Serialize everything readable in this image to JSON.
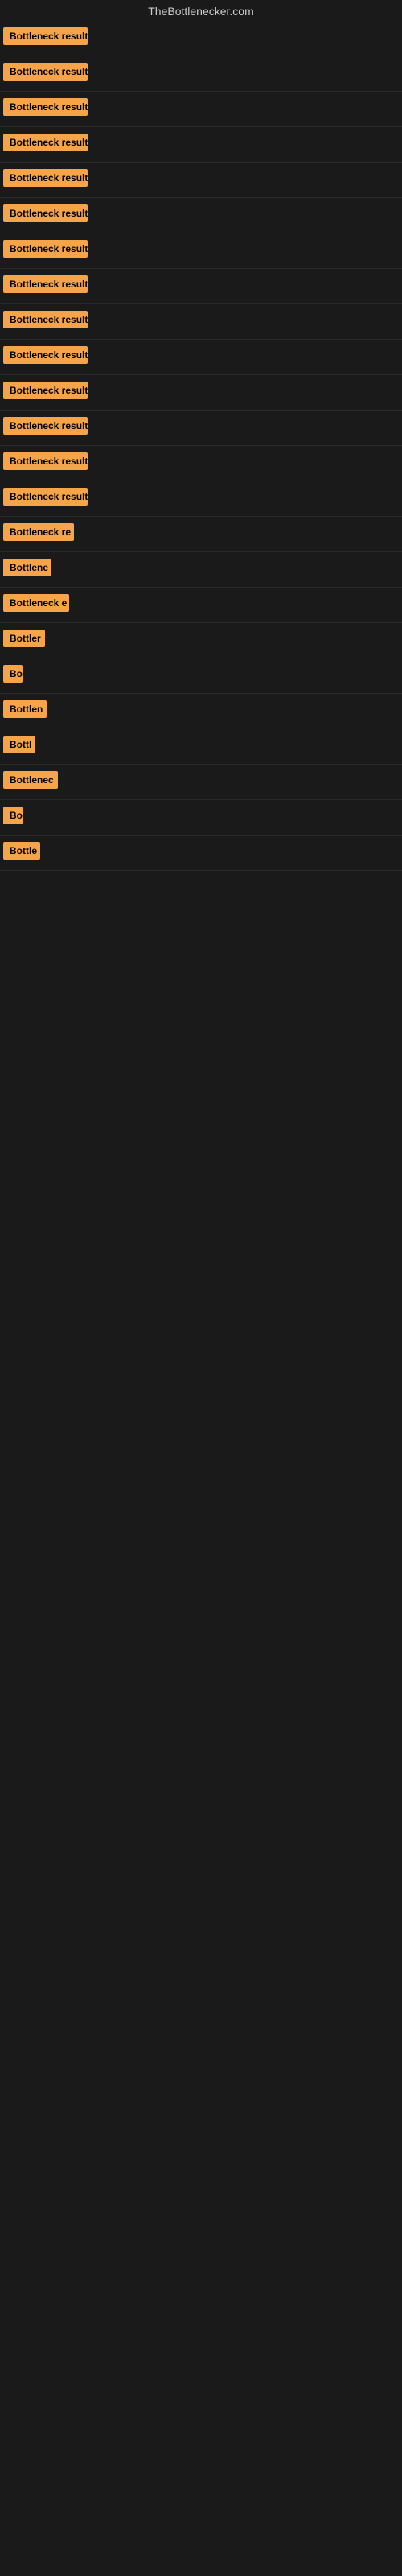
{
  "site": {
    "title": "TheBottlenecker.com"
  },
  "results": [
    {
      "id": 1,
      "label": "Bottleneck result",
      "visible_text": "Bottleneck result"
    },
    {
      "id": 2,
      "label": "Bottleneck result",
      "visible_text": "Bottleneck result"
    },
    {
      "id": 3,
      "label": "Bottleneck result",
      "visible_text": "Bottleneck result"
    },
    {
      "id": 4,
      "label": "Bottleneck result",
      "visible_text": "Bottleneck result"
    },
    {
      "id": 5,
      "label": "Bottleneck result",
      "visible_text": "Bottleneck result"
    },
    {
      "id": 6,
      "label": "Bottleneck result",
      "visible_text": "Bottleneck result"
    },
    {
      "id": 7,
      "label": "Bottleneck result",
      "visible_text": "Bottleneck result"
    },
    {
      "id": 8,
      "label": "Bottleneck result",
      "visible_text": "Bottleneck result"
    },
    {
      "id": 9,
      "label": "Bottleneck result",
      "visible_text": "Bottleneck result"
    },
    {
      "id": 10,
      "label": "Bottleneck result",
      "visible_text": "Bottleneck result"
    },
    {
      "id": 11,
      "label": "Bottleneck result",
      "visible_text": "Bottleneck result"
    },
    {
      "id": 12,
      "label": "Bottleneck result",
      "visible_text": "Bottleneck result"
    },
    {
      "id": 13,
      "label": "Bottleneck result",
      "visible_text": "Bottleneck result"
    },
    {
      "id": 14,
      "label": "Bottleneck result",
      "visible_text": "Bottleneck result"
    },
    {
      "id": 15,
      "label": "Bottleneck re",
      "visible_text": "Bottleneck re"
    },
    {
      "id": 16,
      "label": "Bottlene",
      "visible_text": "Bottlene"
    },
    {
      "id": 17,
      "label": "Bottleneck e",
      "visible_text": "Bottleneck e"
    },
    {
      "id": 18,
      "label": "Bottler",
      "visible_text": "Bottler"
    },
    {
      "id": 19,
      "label": "Bo",
      "visible_text": "Bo"
    },
    {
      "id": 20,
      "label": "Bottlen",
      "visible_text": "Bottlen"
    },
    {
      "id": 21,
      "label": "Bottl",
      "visible_text": "Bottl"
    },
    {
      "id": 22,
      "label": "Bottlenec",
      "visible_text": "Bottlenec"
    },
    {
      "id": 23,
      "label": "Bo",
      "visible_text": "Bo"
    },
    {
      "id": 24,
      "label": "Bottle",
      "visible_text": "Bottle"
    }
  ]
}
